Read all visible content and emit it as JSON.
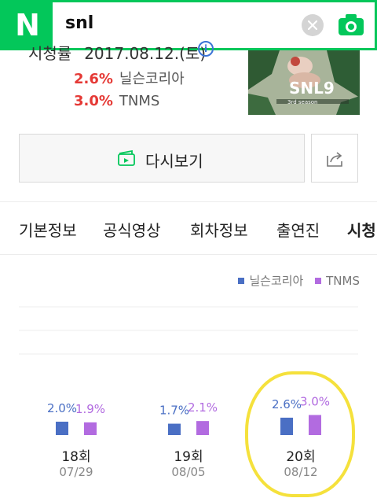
{
  "search": {
    "logo": "N",
    "query": "snl"
  },
  "info": {
    "airdate_label": "시청률",
    "airdate_value": "2017.08.12.(토)",
    "info_icon": "i",
    "ratings": [
      {
        "value": "2.6%",
        "source": "닐슨코리아"
      },
      {
        "value": "3.0%",
        "source": "TNMS"
      }
    ]
  },
  "poster": {
    "title_art": "SNL9",
    "caption": "3rd season"
  },
  "actions": {
    "replay_label": "다시보기"
  },
  "tabs": [
    {
      "label": "기본정보"
    },
    {
      "label": "공식영상"
    },
    {
      "label": "회차정보"
    },
    {
      "label": "출연진"
    },
    {
      "label": "시청"
    }
  ],
  "chart_data": {
    "type": "bar",
    "legend": [
      {
        "name": "닐슨코리아",
        "color": "#4a6fc4"
      },
      {
        "name": "TNMS",
        "color": "#b26be0"
      }
    ],
    "categories": [
      "18회",
      "19회",
      "20회"
    ],
    "dates": [
      "07/29",
      "08/05",
      "08/12"
    ],
    "series": [
      {
        "name": "닐슨코리아",
        "values": [
          2.0,
          1.7,
          2.6
        ],
        "labels": [
          "2.0%",
          "1.7%",
          "2.6%"
        ]
      },
      {
        "name": "TNMS",
        "values": [
          1.9,
          2.1,
          3.0
        ],
        "labels": [
          "1.9%",
          "2.1%",
          "3.0%"
        ]
      }
    ],
    "grid": true
  }
}
